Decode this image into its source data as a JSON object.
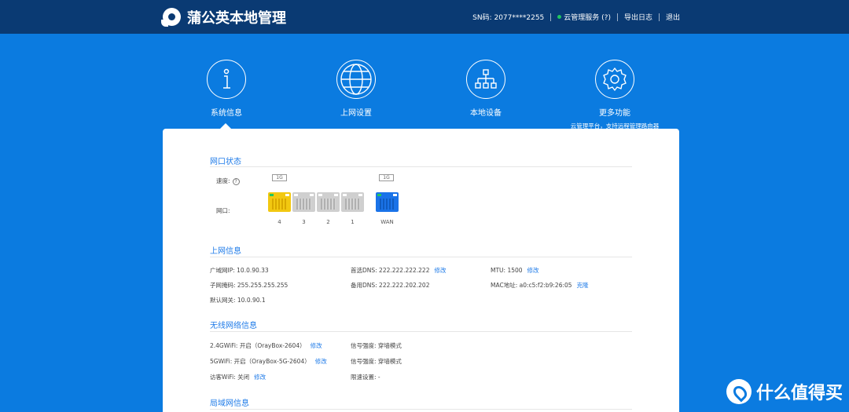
{
  "header": {
    "title": "蒲公英本地管理",
    "sn": "SN码: 2077****2255",
    "cloud_service": "云管理服务 (?)",
    "export_log": "导出日志",
    "logout": "退出"
  },
  "tabs": [
    {
      "label": "系统信息",
      "icon": "info-icon"
    },
    {
      "label": "上网设置",
      "icon": "globe-icon"
    },
    {
      "label": "本地设备",
      "icon": "network-tree-icon"
    },
    {
      "label": "更多功能",
      "sub": "云管理平台，支持远程管理路由器",
      "icon": "gear-icon"
    }
  ],
  "ports_section": {
    "title": "网口状态",
    "speed_label": "速度:",
    "help": "?",
    "port_label": "网口:",
    "lan_speed": "1G",
    "wan_speed": "1G",
    "ports": [
      {
        "label": "4",
        "color": "#f2c811",
        "active": true
      },
      {
        "label": "3",
        "color": "#c9c9c9",
        "active": false
      },
      {
        "label": "2",
        "color": "#c9c9c9",
        "active": false
      },
      {
        "label": "1",
        "color": "#c9c9c9",
        "active": false
      },
      {
        "label": "WAN",
        "color": "#1a73e8",
        "active": true
      }
    ]
  },
  "internet_section": {
    "title": "上网信息",
    "wan_ip": "广域网IP: 10.0.90.33",
    "subnet_mask": "子网掩码: 255.255.255.255",
    "gateway": "默认网关: 10.0.90.1",
    "dns1": "首选DNS: 222.222.222.222",
    "dns2": "备用DNS: 222.222.202.202",
    "mtu": "MTU: 1500",
    "mac": "MAC地址: a0:c5:f2:b9:26:05",
    "edit": "修改",
    "clone": "克隆"
  },
  "wireless_section": {
    "title": "无线网络信息",
    "wifi24": "2.4GWiFi: 开启（OrayBox-2604）",
    "wifi5": "5GWiFi: 开启（OrayBox-5G-2604）",
    "guest": "访客WiFi: 关闭",
    "signal1": "信号强度: 穿墙模式",
    "signal2": "信号强度: 穿墙模式",
    "speed_limit": "限速设置: -",
    "edit": "修改"
  },
  "lan_section": {
    "title": "局域网信息"
  },
  "watermark": "什么值得买",
  "colors": {
    "header_bg": "#0a3a73",
    "page_bg": "#0b7be0",
    "accent": "#1f7be8"
  }
}
